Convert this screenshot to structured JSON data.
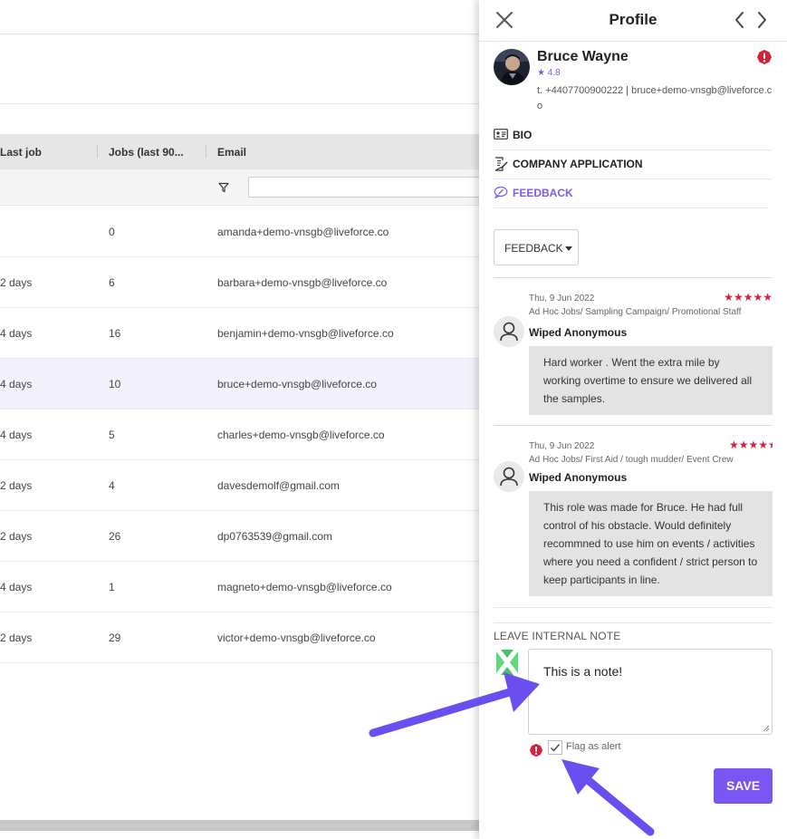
{
  "table": {
    "headers": [
      "Last job",
      "Jobs (last 90...",
      "Email"
    ],
    "rows": [
      {
        "last_job": "",
        "jobs": "0",
        "email": "amanda+demo-vnsgb@liveforce.co"
      },
      {
        "last_job": "2 days",
        "jobs": "6",
        "email": "barbara+demo-vnsgb@liveforce.co"
      },
      {
        "last_job": "4 days",
        "jobs": "16",
        "email": "benjamin+demo-vnsgb@liveforce.co"
      },
      {
        "last_job": "4 days",
        "jobs": "10",
        "email": "bruce+demo-vnsgb@liveforce.co"
      },
      {
        "last_job": "4 days",
        "jobs": "5",
        "email": "charles+demo-vnsgb@liveforce.co"
      },
      {
        "last_job": "2 days",
        "jobs": "4",
        "email": "davesdemolf@gmail.com"
      },
      {
        "last_job": "2 days",
        "jobs": "26",
        "email": "dp0763539@gmail.com"
      },
      {
        "last_job": "4 days",
        "jobs": "1",
        "email": "magneto+demo-vnsgb@liveforce.co"
      },
      {
        "last_job": "2 days",
        "jobs": "29",
        "email": "victor+demo-vnsgb@liveforce.co"
      }
    ]
  },
  "profile": {
    "title": "Profile",
    "name": "Bruce Wayne",
    "rating": "4.8",
    "contact": "t. +4407700900222 | bruce+demo-vnsgb@liveforce.co",
    "menu": {
      "bio": "BIO",
      "company_application": "COMPANY APPLICATION",
      "feedback": "FEEDBACK"
    },
    "dropdown": "FEEDBACK",
    "feedback": [
      {
        "date": "Thu, 9 Jun 2022",
        "stars": 5,
        "job": "Ad Hoc Jobs/ Sampling Campaign/ Promotional Staff",
        "reviewer": "Wiped Anonymous",
        "text": "Hard worker . Went the extra mile by working overtime to ensure we delivered all the samples."
      },
      {
        "date": "Thu, 9 Jun 2022",
        "stars": 4.5,
        "job": "Ad Hoc Jobs/ First Aid / tough mudder/ Event Crew",
        "reviewer": "Wiped Anonymous",
        "text": "This role was made for Bruce. He had full control of his obstacle. Would definitely recommned to use him on events / activities where you need a confident / strict person to keep participants in line."
      }
    ],
    "note": {
      "label": "LEAVE INTERNAL NOTE",
      "value": "This is a note!",
      "flag_label": "Flag as alert",
      "flag_checked": true,
      "save_label": "SAVE"
    }
  },
  "colors": {
    "accent": "#7b55f2",
    "star": "#d6213a",
    "alert": "#d6213a"
  }
}
